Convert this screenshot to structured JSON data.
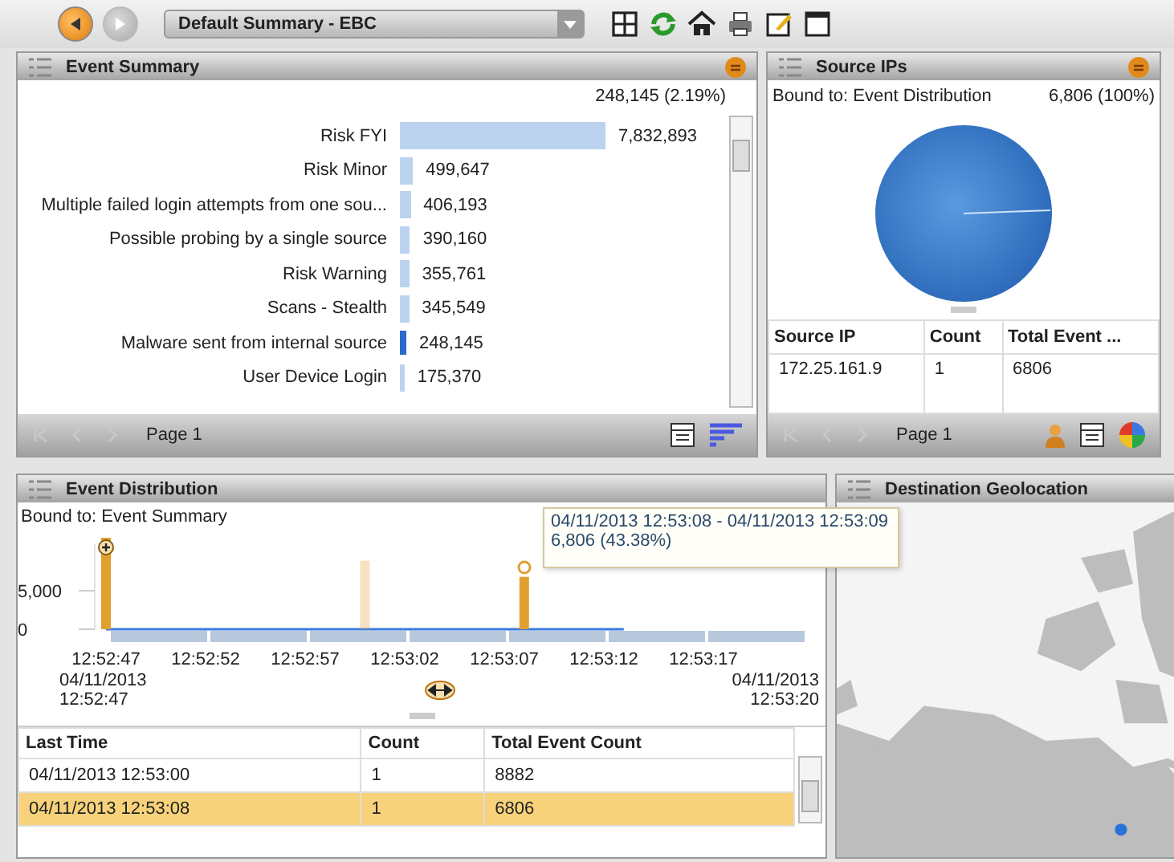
{
  "toolbar": {
    "back": {
      "disabled": false
    },
    "forward": {
      "disabled": true
    },
    "view_select": {
      "value": "Default Summary - EBC"
    }
  },
  "event_summary": {
    "title": "Event Summary",
    "total": "248,145 (2.19%)",
    "rows": [
      {
        "label": "Risk FYI",
        "count": "7,832,893",
        "selected": false
      },
      {
        "label": "Risk Minor",
        "count": "499,647",
        "selected": false
      },
      {
        "label": "Multiple failed login attempts from one sou...",
        "count": "406,193",
        "selected": false
      },
      {
        "label": "Possible probing by a single source",
        "count": "390,160",
        "selected": false
      },
      {
        "label": "Risk Warning",
        "count": "355,761",
        "selected": false
      },
      {
        "label": "Scans - Stealth",
        "count": "345,549",
        "selected": false
      },
      {
        "label": "Malware sent from internal source",
        "count": "248,145",
        "selected": true
      },
      {
        "label": "User Device Login",
        "count": "175,370",
        "selected": false
      }
    ],
    "page": "Page 1"
  },
  "source_ips": {
    "title": "Source IPs",
    "bound_to": "Bound to: Event Distribution",
    "total": "6,806 (100%)",
    "table": {
      "columns": [
        "Source IP",
        "Count",
        "Total Event ..."
      ],
      "rows": [
        [
          "172.25.161.9",
          "1",
          "6806"
        ]
      ]
    },
    "page": "Page 1"
  },
  "event_distribution": {
    "title": "Event Distribution",
    "bound_to": "Bound to: Event Summary",
    "chart_data": {
      "type": "bar",
      "ylim": [
        0,
        11000
      ],
      "categories": [
        "12:52:47",
        null,
        null,
        null,
        null,
        "12:52:52",
        null,
        null,
        null,
        null,
        "12:52:57",
        null,
        null,
        null,
        null,
        "12:53:02",
        null,
        null,
        null,
        null,
        "12:53:07",
        null,
        null,
        null,
        null,
        "12:53:12",
        null,
        null,
        null,
        null,
        "12:53:17",
        null,
        null,
        null
      ],
      "yticks": [
        {
          "value": 0,
          "label": "0"
        },
        {
          "value": 5000,
          "label": "5,000"
        }
      ],
      "series": [
        {
          "color": "#e0a030",
          "values": [
            null,
            null,
            null,
            null,
            null,
            null,
            null,
            null,
            null,
            null,
            null,
            null,
            null,
            8900,
            null,
            null,
            null,
            null,
            null,
            null,
            null,
            6800,
            null,
            null,
            null,
            null,
            null,
            null,
            null,
            null,
            null,
            null,
            null,
            null
          ]
        }
      ]
    },
    "range_start": [
      "04/11/2013",
      "12:52:47"
    ],
    "range_end": [
      "04/11/2013",
      "12:53:20"
    ],
    "tooltip": {
      "range": "04/11/2013 12:53:08 - 04/11/2013 12:53:09",
      "value": "6,806 (43.38%)"
    },
    "table": {
      "columns": [
        "Last Time",
        "Count",
        "Total Event Count"
      ],
      "rows": [
        {
          "cells": [
            "04/11/2013 12:53:00",
            "1",
            "8882"
          ],
          "selected": false
        },
        {
          "cells": [
            "04/11/2013 12:53:08",
            "1",
            "6806"
          ],
          "selected": true
        }
      ]
    }
  },
  "destination_geolocation": {
    "title": "Destination Geolocation"
  }
}
